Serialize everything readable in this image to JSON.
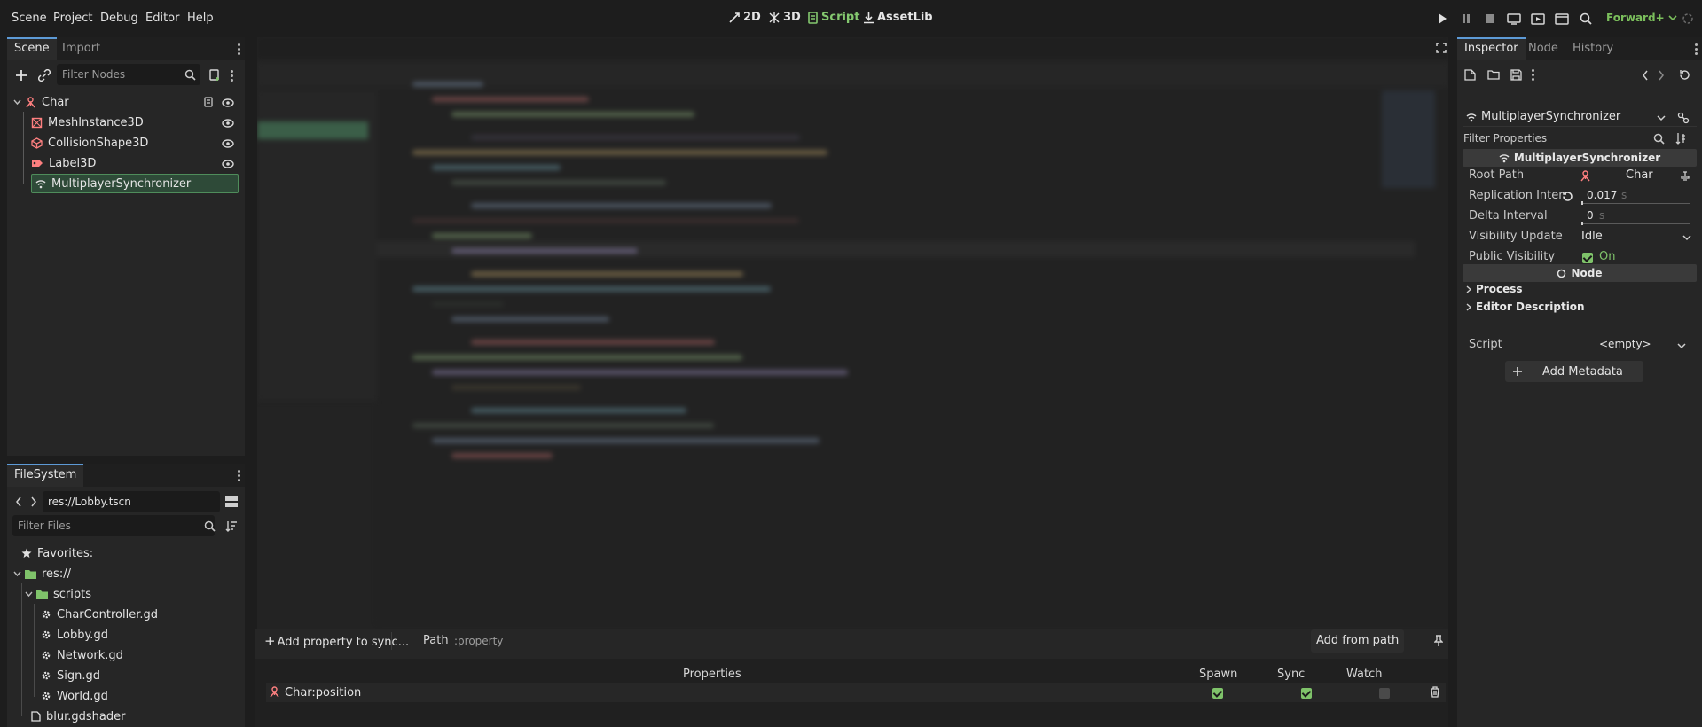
{
  "menu": {
    "items": [
      "Scene",
      "Project",
      "Debug",
      "Editor",
      "Help"
    ]
  },
  "workspaces": {
    "w2d": "2D",
    "w3d": "3D",
    "script": "Script",
    "assetlib": "AssetLib",
    "active": "Script"
  },
  "renderer": {
    "label": "Forward+"
  },
  "scene_dock": {
    "tabs": [
      "Scene",
      "Import"
    ],
    "filter_placeholder": "Filter Nodes",
    "nodes": [
      {
        "name": "Char",
        "icon": "character-icon",
        "color": "#fc7f7f"
      },
      {
        "name": "MeshInstance3D",
        "icon": "mesh-instance-icon",
        "color": "#fc7f7f"
      },
      {
        "name": "CollisionShape3D",
        "icon": "collision-shape-icon",
        "color": "#fc7f7f"
      },
      {
        "name": "Label3D",
        "icon": "label3d-icon",
        "color": "#fc7f7f"
      },
      {
        "name": "MultiplayerSynchronizer",
        "icon": "multiplayer-sync-icon",
        "color": "#e0e0e0"
      }
    ]
  },
  "filesystem": {
    "tab": "FileSystem",
    "path": "res://Lobby.tscn",
    "filter_placeholder": "Filter Files",
    "favorites": "Favorites:",
    "root": "res://",
    "folder": "scripts",
    "files": [
      "CharController.gd",
      "Lobby.gd",
      "Network.gd",
      "Sign.gd",
      "World.gd"
    ],
    "extra_file": "blur.gdshader"
  },
  "sync_panel": {
    "add_property": "Add property to sync...",
    "path_label": "Path:",
    "path_placeholder": ":property",
    "add_from_path": "Add from path",
    "columns": {
      "properties": "Properties",
      "spawn": "Spawn",
      "sync": "Sync",
      "watch": "Watch"
    },
    "rows": [
      {
        "property": "Char:position",
        "spawn": true,
        "sync": true,
        "watch": false
      }
    ]
  },
  "inspector": {
    "tabs": [
      "Inspector",
      "Node",
      "History"
    ],
    "object_name": "MultiplayerSynchronizer",
    "filter_placeholder": "Filter Properties",
    "section_title": "MultiplayerSynchronizer",
    "props": {
      "root_path_label": "Root Path",
      "root_path_value": "Char",
      "replication_label": "Replication Inter...",
      "replication_value": "0.017",
      "replication_unit": "s",
      "delta_label": "Delta Interval",
      "delta_value": "0",
      "delta_unit": "s",
      "visibility_mode_label": "Visibility Update M...",
      "visibility_mode_value": "Idle",
      "public_visibility_label": "Public Visibility",
      "public_visibility_value": "On"
    },
    "node_section": "Node",
    "groups": [
      "Process",
      "Editor Description"
    ],
    "script_label": "Script",
    "script_value": "<empty>",
    "add_metadata": "Add Metadata"
  },
  "colors": {
    "accent_green": "#7fc36a",
    "tab_accent": "#5d9ad6",
    "node_red": "#fc7f7f",
    "panel_bg": "#262626",
    "app_bg": "#1d1d1d"
  }
}
